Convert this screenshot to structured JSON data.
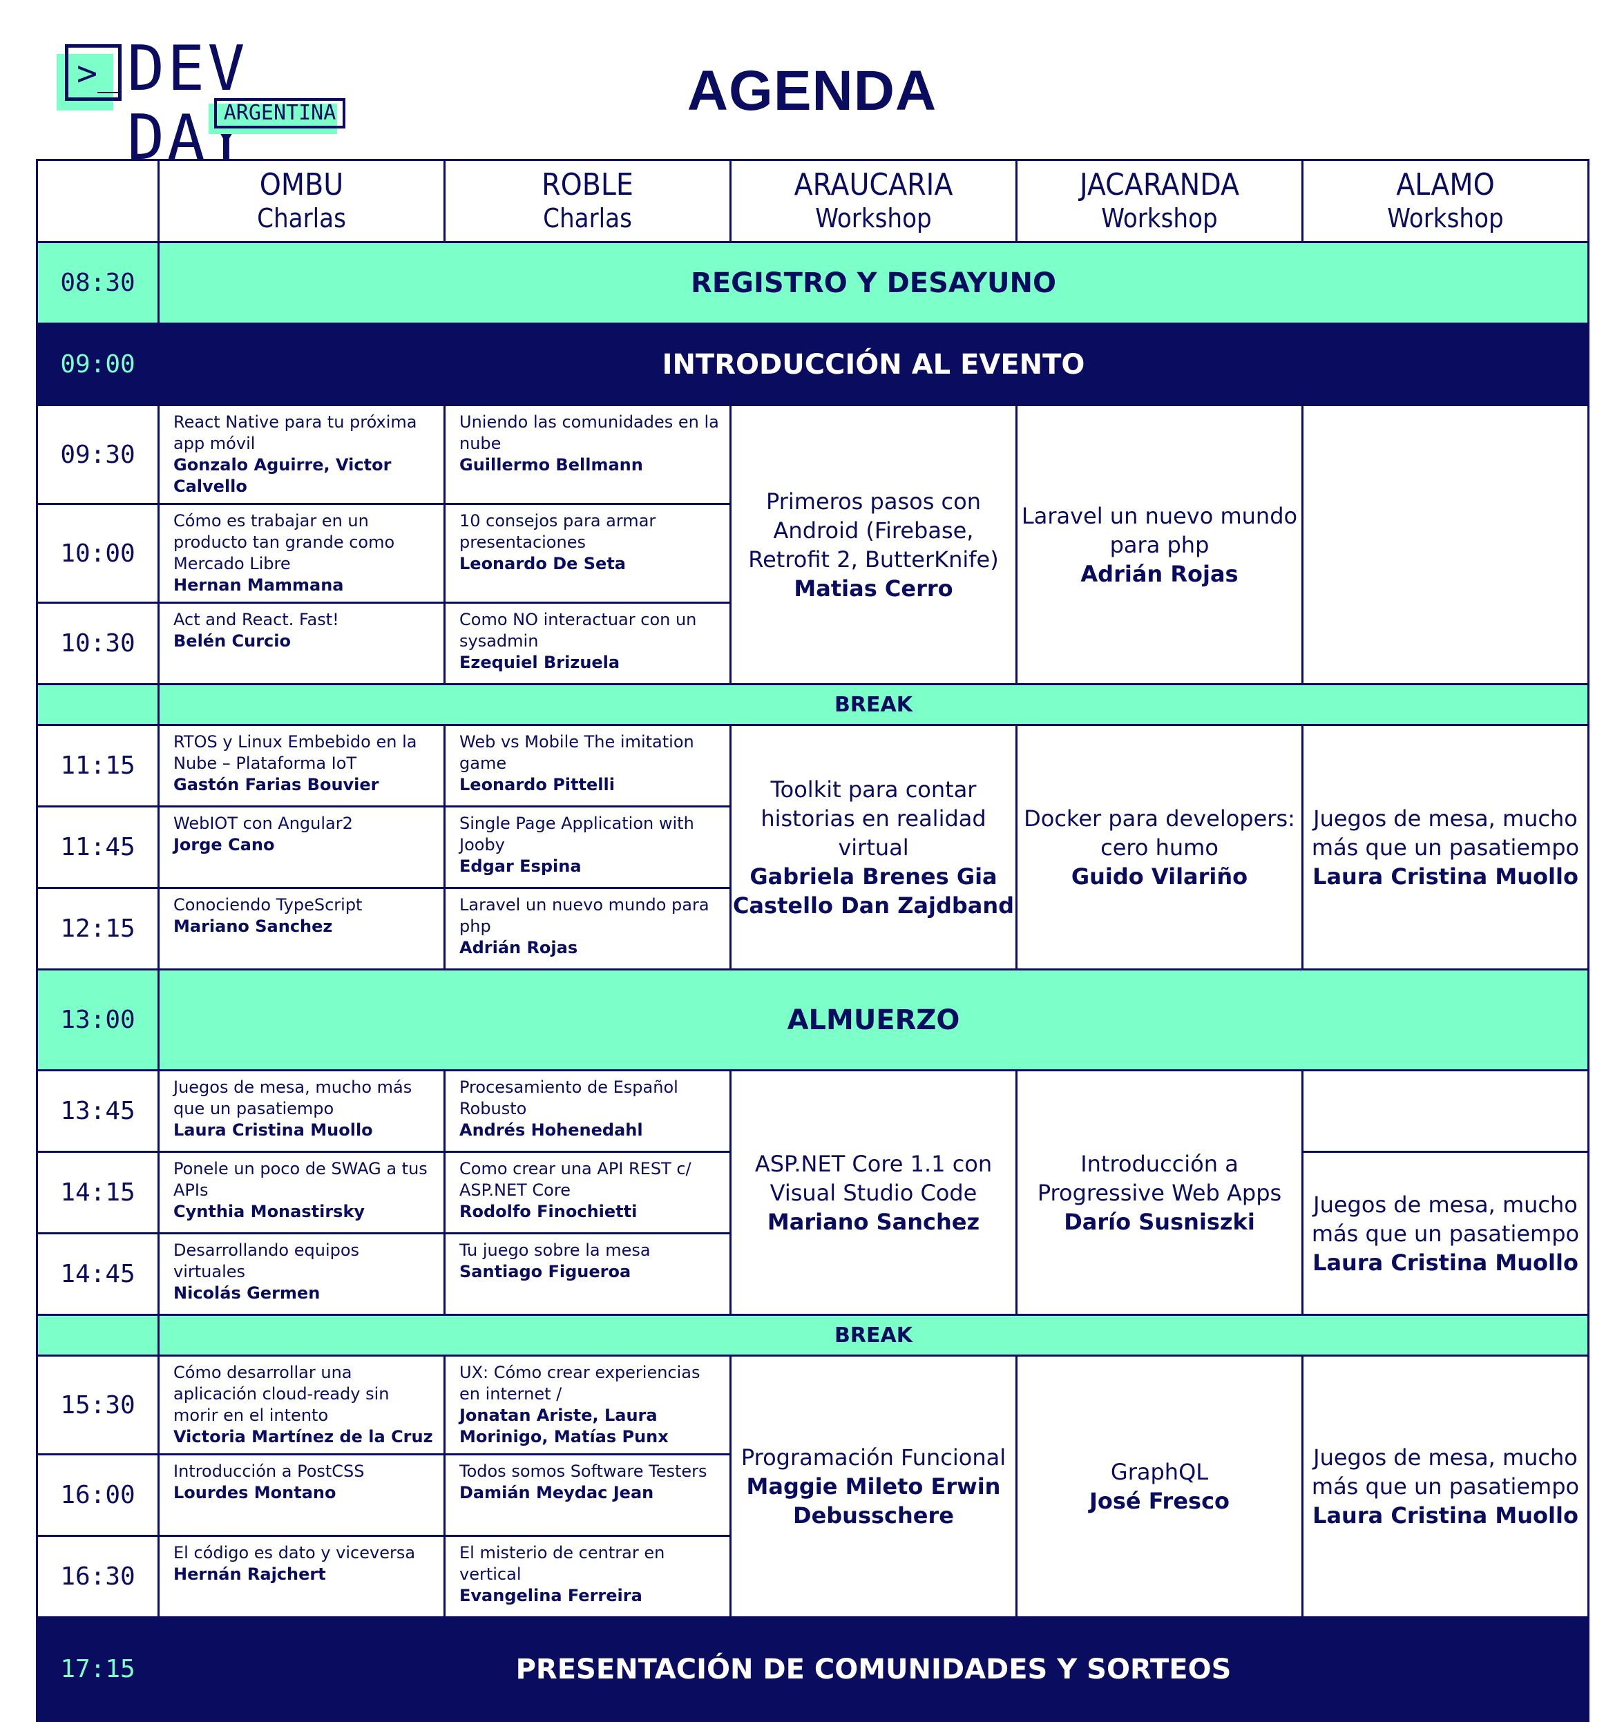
{
  "logo": {
    "prompt": ">_",
    "title": "DEV DAY",
    "subtitle": "ARGENTINA"
  },
  "title": "AGENDA",
  "rooms": [
    {
      "name": "OMBU",
      "kind": "Charlas"
    },
    {
      "name": "ROBLE",
      "kind": "Charlas"
    },
    {
      "name": "ARAUCARIA",
      "kind": "Workshop"
    },
    {
      "name": "JACARANDA",
      "kind": "Workshop"
    },
    {
      "name": "ALAMO",
      "kind": "Workshop"
    }
  ],
  "plenary": {
    "registro": {
      "time": "08:30",
      "label": "REGISTRO Y DESAYUNO"
    },
    "intro": {
      "time": "09:00",
      "label": "INTRODUCCIÓN AL EVENTO"
    },
    "break1": {
      "label": "BREAK"
    },
    "almuerzo": {
      "time": "13:00",
      "label": "ALMUERZO"
    },
    "break2": {
      "label": "BREAK"
    },
    "cierre": {
      "time": "17:15",
      "label": "PRESENTACIÓN DE COMUNIDADES Y SORTEOS"
    }
  },
  "times": [
    "09:30",
    "10:00",
    "10:30",
    "11:15",
    "11:45",
    "12:15",
    "13:45",
    "14:15",
    "14:45",
    "15:30",
    "16:00",
    "16:30"
  ],
  "ombu": [
    {
      "title": "React Native para tu próxima app móvil",
      "speaker": "Gonzalo Aguirre, Victor Calvello"
    },
    {
      "title": "Cómo es trabajar en un producto tan grande como Mercado Libre",
      "speaker": "Hernan Mammana"
    },
    {
      "title": "Act and React. Fast!",
      "speaker": "Belén Curcio"
    },
    {
      "title": "RTOS y Linux Embebido en la Nube – Plataforma IoT",
      "speaker": "Gastón Farias Bouvier"
    },
    {
      "title": "WebIOT con Angular2",
      "speaker": "Jorge Cano"
    },
    {
      "title": "Conociendo TypeScript",
      "speaker": "Mariano Sanchez"
    },
    {
      "title": "Juegos de mesa, mucho más que un pasatiempo",
      "speaker": "Laura Cristina Muollo"
    },
    {
      "title": "Ponele un poco de SWAG a tus APIs",
      "speaker": "Cynthia Monastirsky"
    },
    {
      "title": "Desarrollando equipos virtuales",
      "speaker": "Nicolás Germen"
    },
    {
      "title": "Cómo desarrollar una aplicación cloud-ready sin morir en el intento",
      "speaker": "Victoria Martínez de la Cruz"
    },
    {
      "title": "Introducción a PostCSS",
      "speaker": "Lourdes Montano"
    },
    {
      "title": "El código es dato y viceversa",
      "speaker": "Hernán Rajchert"
    }
  ],
  "roble": [
    {
      "title": "Uniendo las comunidades en la nube",
      "speaker": "Guillermo Bellmann"
    },
    {
      "title": "10 consejos para armar presentaciones",
      "speaker": "Leonardo De Seta"
    },
    {
      "title": "Como NO interactuar con un sysadmin",
      "speaker": "Ezequiel Brizuela"
    },
    {
      "title": "Web vs Mobile The imitation game",
      "speaker": "Leonardo Pittelli"
    },
    {
      "title": "Single Page Application with Jooby",
      "speaker": "Edgar Espina"
    },
    {
      "title": "Laravel un nuevo mundo para php",
      "speaker": "Adrián Rojas"
    },
    {
      "title": "Procesamiento de Español Robusto",
      "speaker": "Andrés Hohenedahl"
    },
    {
      "title": "Como crear una API REST c/ ASP.NET Core",
      "speaker": "Rodolfo Finochietti"
    },
    {
      "title": "Tu juego sobre la mesa",
      "speaker": "Santiago Figueroa"
    },
    {
      "title": "UX: Cómo crear experiencias en internet /",
      "speaker": "Jonatan Ariste, Laura Morinigo, Matías Punx"
    },
    {
      "title": "Todos somos Software Testers",
      "speaker": "Damián Meydac Jean"
    },
    {
      "title": "El misterio de centrar en vertical",
      "speaker": "Evangelina Ferreira"
    }
  ],
  "araucaria": [
    {
      "title": "Primeros pasos con Android (Firebase, Retrofit 2, ButterKnife)",
      "speaker": "Matias Cerro"
    },
    {
      "title": "Toolkit para contar historias en realidad virtual",
      "speaker": "Gabriela Brenes Gia Castello Dan Zajdband"
    },
    {
      "title": "ASP.NET Core 1.1 con Visual Studio Code",
      "speaker": "Mariano Sanchez"
    },
    {
      "title": "Programación Funcional",
      "speaker": "Maggie Mileto Erwin Debusschere"
    }
  ],
  "jacaranda": [
    {
      "title": "Laravel un nuevo mundo para php",
      "speaker": "Adrián Rojas"
    },
    {
      "title": "Docker para developers: cero humo",
      "speaker": "Guido Vilariño"
    },
    {
      "title": "Introducción a Progressive Web Apps",
      "speaker": "Darío Susniszki"
    },
    {
      "title": "GraphQL",
      "speaker": "José Fresco"
    }
  ],
  "alamo": [
    {
      "title": "Juegos de mesa, mucho más que un pasatiempo",
      "speaker": "Laura Cristina Muollo"
    },
    {
      "title": "Juegos de mesa, mucho más que un pasatiempo",
      "speaker": "Laura Cristina Muollo"
    },
    {
      "title": "Juegos de mesa, mucho más que un pasatiempo",
      "speaker": "Laura Cristina Muollo"
    }
  ],
  "colors": {
    "navy": "#0a0c5f",
    "mint": "#7dffca",
    "white": "#ffffff"
  }
}
